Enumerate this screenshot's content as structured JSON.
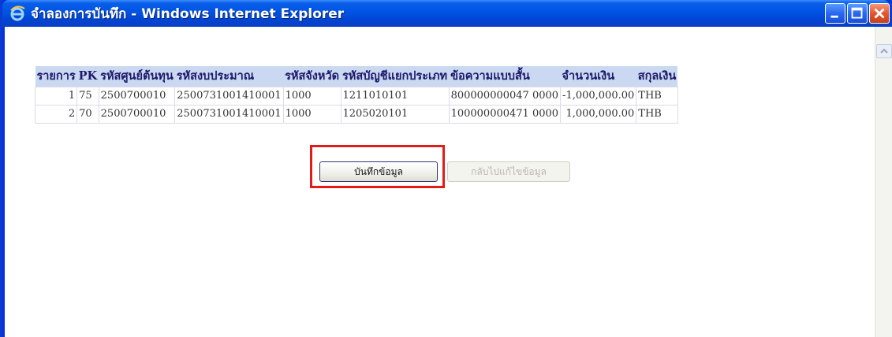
{
  "window": {
    "title": "จำลองการบันทึก - Windows Internet Explorer",
    "icon": "ie-icon"
  },
  "table": {
    "headers": [
      "รายการ",
      "PK",
      "รหัสศูนย์ต้นทุน",
      "รหัสงบประมาณ",
      "รหัสจังหวัด",
      "รหัสบัญชีแยกประเภท",
      "ข้อความแบบสั้น",
      "จำนวนเงิน",
      "สกุลเงิน"
    ],
    "rows": [
      [
        "1",
        "75",
        "2500700010",
        "2500731001410001",
        "1000",
        "1211010101",
        "800000000047 0000",
        "-1,000,000.00",
        "THB"
      ],
      [
        "2",
        "70",
        "2500700010",
        "2500731001410001",
        "1000",
        "1205020101",
        "100000000471 0000",
        "1,000,000.00",
        "THB"
      ]
    ]
  },
  "buttons": {
    "save": "บันทึกข้อมูล",
    "back": "กลับไปแก้ไขข้อมูล"
  },
  "colors": {
    "title_bar": "#0055e5",
    "table_header_bg": "#cbd8f1",
    "highlight": "#e41b1b"
  }
}
